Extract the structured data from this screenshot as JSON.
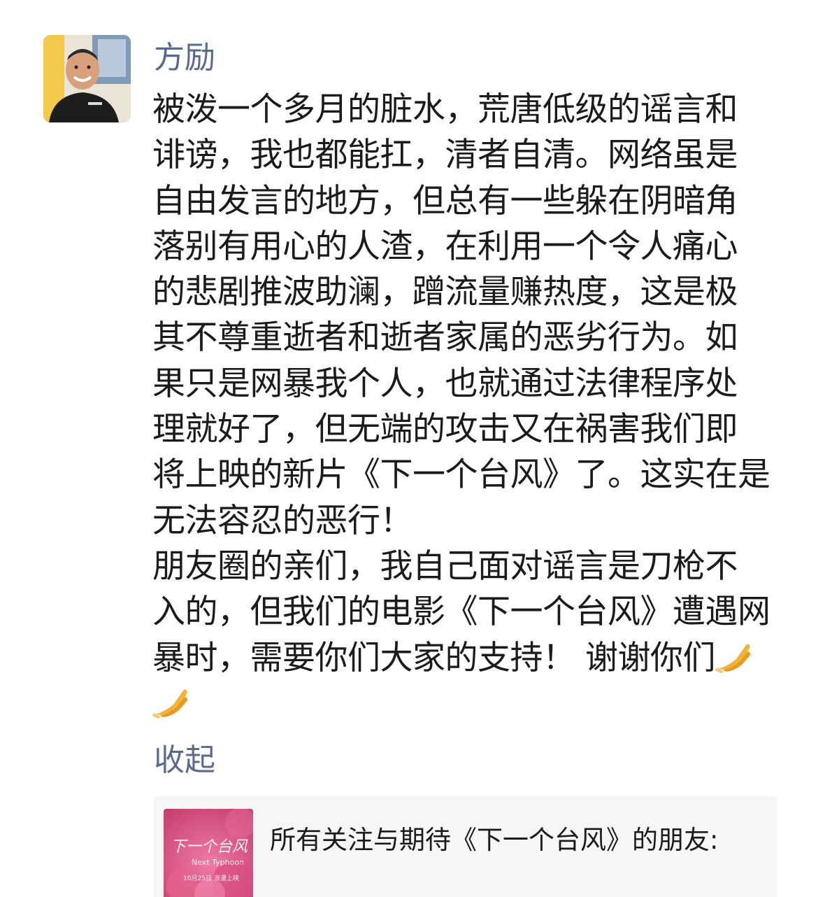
{
  "author": {
    "name": "方励"
  },
  "post": {
    "lines": [
      "被泼一个多月的脏水，荒唐低级的谣言和",
      "诽谤，我也都能扛，清者自清。网络虽是",
      "自由发言的地方，但总有一些躲在阴暗角",
      "落别有用心的人渣，在利用一个令人痛心",
      "的悲剧推波助澜，蹭流量赚热度，这是极",
      "其不尊重逝者和逝者家属的恶劣行为。如",
      "果只是网暴我个人，也就通过法律程序处",
      "理就好了，但无端的攻击又在祸害我们即",
      "将上映的新片《下一个台风》了。这实在是",
      "无法容忍的恶行！",
      "朋友圈的亲们，我自己面对谣言是刀枪不",
      "入的，但我们的电影《下一个台风》遭遇网",
      "暴时，需要你们大家的支持！ 谢谢你们"
    ],
    "emoji_name": "folded-hands"
  },
  "actions": {
    "collapse_label": "收起"
  },
  "link_card": {
    "title": "所有关注与期待《下一个台风》的朋友:",
    "thumbnail": {
      "title": "下一个台风",
      "subtitle": "Next Typhoon",
      "date": "10月25日 浪漫上映"
    }
  },
  "colors": {
    "author_name": "#5a6a8e",
    "body_text": "#1b1b1b",
    "card_background": "#f6f6f6",
    "thumbnail_pink": "#e45a8e"
  }
}
